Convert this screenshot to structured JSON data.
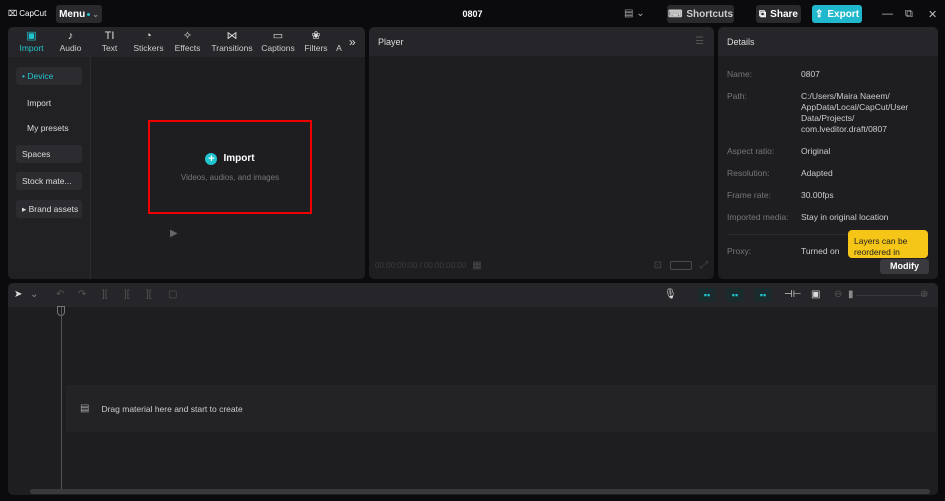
{
  "app": {
    "logo": "CapCut",
    "menu_label": "Menu",
    "project_title": "0807"
  },
  "titlebar": {
    "layout_icon": "layout-icon",
    "shortcuts_label": "Shortcuts",
    "share_label": "Share",
    "export_label": "Export",
    "minimize": "—",
    "restore": "⧉",
    "close": "✕",
    "accent_color": "#1fb8cc"
  },
  "media_tabs": [
    {
      "label": "Import",
      "icon": "▣",
      "active": true
    },
    {
      "label": "Audio",
      "icon": "♪"
    },
    {
      "label": "Text",
      "icon": "TI"
    },
    {
      "label": "Stickers",
      "icon": "◔"
    },
    {
      "label": "Effects",
      "icon": "✧"
    },
    {
      "label": "Transitions",
      "icon": "⋈"
    },
    {
      "label": "Captions",
      "icon": "▭"
    },
    {
      "label": "Filters",
      "icon": "❀"
    },
    {
      "label": "A",
      "icon": ""
    }
  ],
  "more_tabs_icon": "»",
  "sidebar": {
    "items": [
      {
        "label": "• Device",
        "active": true
      },
      {
        "label": "Import"
      },
      {
        "label": "My presets"
      },
      {
        "label": "Spaces"
      },
      {
        "label": "Stock mate..."
      },
      {
        "label": "▸ Brand assets"
      }
    ]
  },
  "import_area": {
    "plus": "+",
    "label": "Import",
    "sub": "Videos, audios, and images"
  },
  "player": {
    "title": "Player",
    "timecode": "00:00:00:00 / 00:00:00:00",
    "play": "▶"
  },
  "details": {
    "title": "Details",
    "rows": [
      {
        "label": "Name:",
        "value": "0807"
      },
      {
        "label": "Path:",
        "value": "C:/Users/Maira Naeem/ AppData/Local/CapCut/User Data/Projects/ com.lveditor.draft/0807"
      },
      {
        "label": "Aspect ratio:",
        "value": "Original"
      },
      {
        "label": "Resolution:",
        "value": "Adapted"
      },
      {
        "label": "Frame rate:",
        "value": "30.00fps"
      },
      {
        "label": "Imported media:",
        "value": "Stay in original location"
      },
      {
        "label": "Proxy:",
        "value": "Turned on"
      }
    ],
    "tooltip": "Layers can be reordered in",
    "modify_label": "Modify"
  },
  "timeline": {
    "drop_hint": "Drag material here and start to create"
  }
}
